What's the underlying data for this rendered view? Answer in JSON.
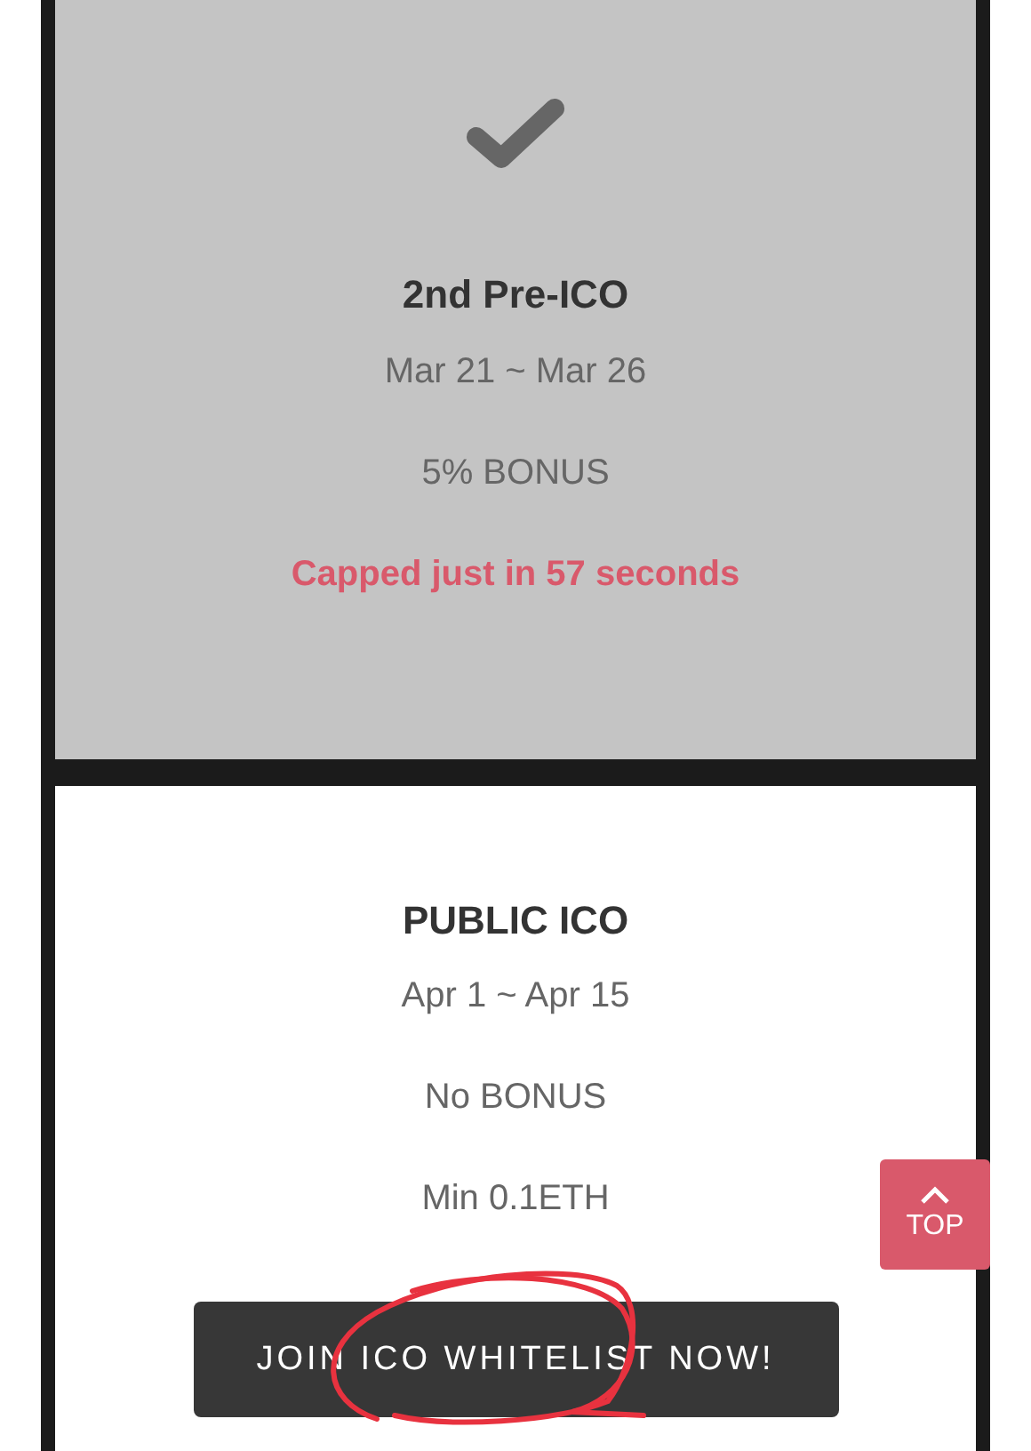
{
  "stages": [
    {
      "title": "2nd Pre-ICO",
      "dates": "Mar 21 ~ Mar 26",
      "bonus": "5% BONUS",
      "completed": true,
      "note": "Capped just in 57 seconds"
    },
    {
      "title": "PUBLIC ICO",
      "dates": "Apr 1 ~ Apr 15",
      "bonus": "No BONUS",
      "completed": false,
      "minimum": "Min 0.1ETH",
      "button": "JOIN ICO WHITELIST NOW!"
    }
  ],
  "top_button": {
    "label": "TOP"
  },
  "annotation": {
    "kind": "circle"
  }
}
